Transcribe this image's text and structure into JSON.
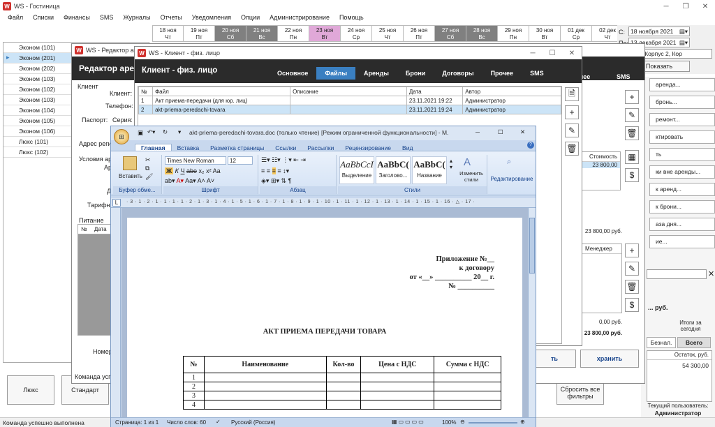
{
  "main": {
    "title": "WS - Гостиница",
    "menu": [
      "Файл",
      "Списки",
      "Финансы",
      "SMS",
      "Журналы",
      "Отчеты",
      "Уведомления",
      "Опции",
      "Администрирование",
      "Помощь"
    ],
    "dates": [
      {
        "d": "18 ноя",
        "w": "Чт",
        "s": ""
      },
      {
        "d": "19 ноя",
        "w": "Пт",
        "s": ""
      },
      {
        "d": "20 ноя",
        "w": "Сб",
        "s": "dark"
      },
      {
        "d": "21 ноя",
        "w": "Вс",
        "s": "dark"
      },
      {
        "d": "22 ноя",
        "w": "Пн",
        "s": ""
      },
      {
        "d": "23 ноя",
        "w": "Вт",
        "s": "pink"
      },
      {
        "d": "24 ноя",
        "w": "Ср",
        "s": ""
      },
      {
        "d": "25 ноя",
        "w": "Чт",
        "s": ""
      },
      {
        "d": "26 ноя",
        "w": "Пт",
        "s": ""
      },
      {
        "d": "27 ноя",
        "w": "Сб",
        "s": "dark"
      },
      {
        "d": "28 ноя",
        "w": "Вс",
        "s": "dark"
      },
      {
        "d": "29 ноя",
        "w": "Пн",
        "s": ""
      },
      {
        "d": "30 ноя",
        "w": "Вт",
        "s": ""
      },
      {
        "d": "01 дек",
        "w": "Ср",
        "s": ""
      },
      {
        "d": "02 дек",
        "w": "Чт",
        "s": ""
      }
    ],
    "filter": {
      "from_label": "С:",
      "from_date": "18 ноября 2021",
      "to_label": "По:",
      "to_date": "13 декабря 2021",
      "building": "ус 1, Корпус 2, Кор",
      "show_button": "Показать"
    },
    "rooms": [
      "Эконом (101)",
      "Эконом (201)",
      "Эконом (202)",
      "Эконом (103)",
      "Эконом (102)",
      "Эконом (103)",
      "Эконом (104)",
      "Эконом (105)",
      "Эконом (106)",
      "Люкс (101)",
      "Люкс (102)"
    ],
    "bottom_buttons": [
      "Люкс",
      "Стандарт"
    ],
    "reset_filters": "Сбросить все фильтры",
    "status": "Команда успешно выполнена",
    "right_panel": {
      "buttons": [
        "аренда...",
        "бронь...",
        "ремонт...",
        "ктировать",
        "ть",
        "ки вне аренды...",
        "к аренд...",
        "к брони...",
        "аза дня...",
        "ие..."
      ],
      "totals_label": "... руб.",
      "totals_today_label": "Итоги за сегодня",
      "tab_cashless": "Безнал.",
      "tab_total": "Всего",
      "balance_header": "Остаток, руб.",
      "balance_value": "54 300,00",
      "current_user_label": "Текущий пользователь:",
      "current_user": "Администратор"
    }
  },
  "rental_editor": {
    "title": "WS - Редактор аре",
    "header": "Редактор аре",
    "fields": {
      "client": "Клиент",
      "client_sub": "Клиент:",
      "phone": "Телефон:",
      "passport": "Паспорт:",
      "series": "Серия:",
      "address": "Адрес регис",
      "conditions": "Условия аре",
      "ar": "Ар",
      "d": "Д",
      "tariff": "Тарифна"
    },
    "food_label": "Питание",
    "food_cols": [
      "№",
      "Дата"
    ],
    "number_label": "Номер",
    "status": "Команда успе",
    "cost_header": "Стоимость",
    "cost_value": "23 800,00",
    "sum1": "23 800,00 руб.",
    "manager_header": "Менеджер",
    "sum_zero": "0,00 руб.",
    "sum_total": "23 800,00 руб.",
    "save_button": "ть",
    "save_button2": "хранить",
    "tabs_extra": [
      "чее",
      "SMS"
    ]
  },
  "client_window": {
    "title": "WS - Клиент - физ. лицо",
    "header": "Клиент - физ. лицо",
    "tabs": [
      "Основное",
      "Файлы",
      "Аренды",
      "Брони",
      "Договоры",
      "Прочее",
      "SMS"
    ],
    "active_tab": "Файлы",
    "columns": [
      "№",
      "Файл",
      "Описание",
      "Дата",
      "Автор"
    ],
    "rows": [
      [
        "1",
        "Акт приема-передачи (для юр. лиц)",
        "",
        "23.11.2021 19:22",
        "Администратор"
      ],
      [
        "2",
        "akt-priema-peredachi-tovara",
        "",
        "23.11.2021 19:24",
        "Администратор"
      ]
    ]
  },
  "word": {
    "title": "akt-priema-peredachi-tovara.doc (только чтение) [Режим ограниченной функциональности] - M.",
    "tabs": [
      "Главная",
      "Вставка",
      "Разметка страницы",
      "Ссылки",
      "Рассылки",
      "Рецензирование",
      "Вид"
    ],
    "active_tab": "Главная",
    "paste_label": "Вставить",
    "font_name": "Times New Roman",
    "font_size": "12",
    "groups": [
      "Буфер обме...",
      "Шрифт",
      "Абзац",
      "Стили",
      "Редактирование"
    ],
    "styles": [
      {
        "preview": "AaBbCcI",
        "name": "Выделение"
      },
      {
        "preview": "AaBbC(",
        "name": "Заголово..."
      },
      {
        "preview": "AaBbC(",
        "name": "Название"
      }
    ],
    "change_styles": "Изменить стили",
    "editing": "Редактирование",
    "ruler": "· 3 · 1 · 2 · 1 · 1 · 1 · 1 · 2 · 1 · 3 · 1 · 4 · 1 · 5 · 1 · 6 · 1 · 7 · 1 · 8 · 1 · 9 · 1 · 10 · 1 · 11 · 1 · 12 · 1 · 13 · 1 · 14 · 1 · 15 · 1 · 16 · △ · 17 ·",
    "doc": {
      "appendix": "Приложение №__",
      "to_contract": "к договору",
      "from": "от «__» __________ 20__ г.",
      "number": "№ __________",
      "heading": "АКТ ПРИЕМА ПЕРЕДАЧИ ТОВАРА",
      "table_headers": [
        "№",
        "Наименование",
        "Кол-во",
        "Цена с НДС",
        "Сумма с НДС"
      ],
      "table_rows": [
        "1",
        "2",
        "3",
        "4"
      ]
    },
    "statusbar": {
      "page": "Страница: 1 из 1",
      "words": "Число слов: 60",
      "lang": "Русский (Россия)",
      "zoom": "100%"
    }
  }
}
